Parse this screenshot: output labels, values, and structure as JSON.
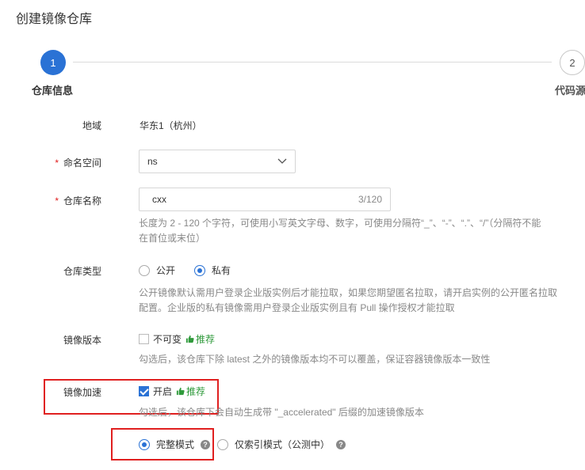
{
  "page": {
    "title": "创建镜像仓库"
  },
  "steps": [
    {
      "number": "1",
      "label": "仓库信息"
    },
    {
      "number": "2",
      "label": "代码源"
    }
  ],
  "form": {
    "region": {
      "label": "地域",
      "value": "华东1（杭州）"
    },
    "namespace": {
      "required_mark": "*",
      "label": "命名空间",
      "value": "ns"
    },
    "repo_name": {
      "required_mark": "*",
      "label": "仓库名称",
      "value": "cxx",
      "counter": "3/120",
      "help_line1": "长度为 2 - 120 个字符，可使用小写英文字母、数字，可使用分隔符“_”、“-”、“.”、“/”（分隔符不能",
      "help_line2": "在首位或末位）"
    },
    "repo_type": {
      "label": "仓库类型",
      "options": [
        {
          "label": "公开",
          "selected": false
        },
        {
          "label": "私有",
          "selected": true
        }
      ],
      "help_line1": "公开镜像默认需用户登录企业版实例后才能拉取，如果您期望匿名拉取，请开启实例的公开匿名拉取",
      "help_line2": "配置。企业版的私有镜像需用户登录企业版实例且有 Pull 操作授权才能拉取"
    },
    "image_version": {
      "label": "镜像版本",
      "checkbox_label": "不可变",
      "checked": false,
      "recommend": "推荐",
      "help": "勾选后，该仓库下除 latest 之外的镜像版本均不可以覆盖，保证容器镜像版本一致性"
    },
    "image_accel": {
      "label": "镜像加速",
      "checkbox_label": "开启",
      "checked": true,
      "recommend": "推荐",
      "help": "勾选后，该仓库下会自动生成带 \"_accelerated\" 后缀的加速镜像版本",
      "modes": [
        {
          "label": "完整模式",
          "selected": true
        },
        {
          "label": "仅索引模式（公测中）",
          "selected": false
        }
      ]
    }
  },
  "colors": {
    "primary": "#2a72d5",
    "required": "#e02020",
    "recommend": "#2f9a3b",
    "highlight_box": "#e02020"
  }
}
